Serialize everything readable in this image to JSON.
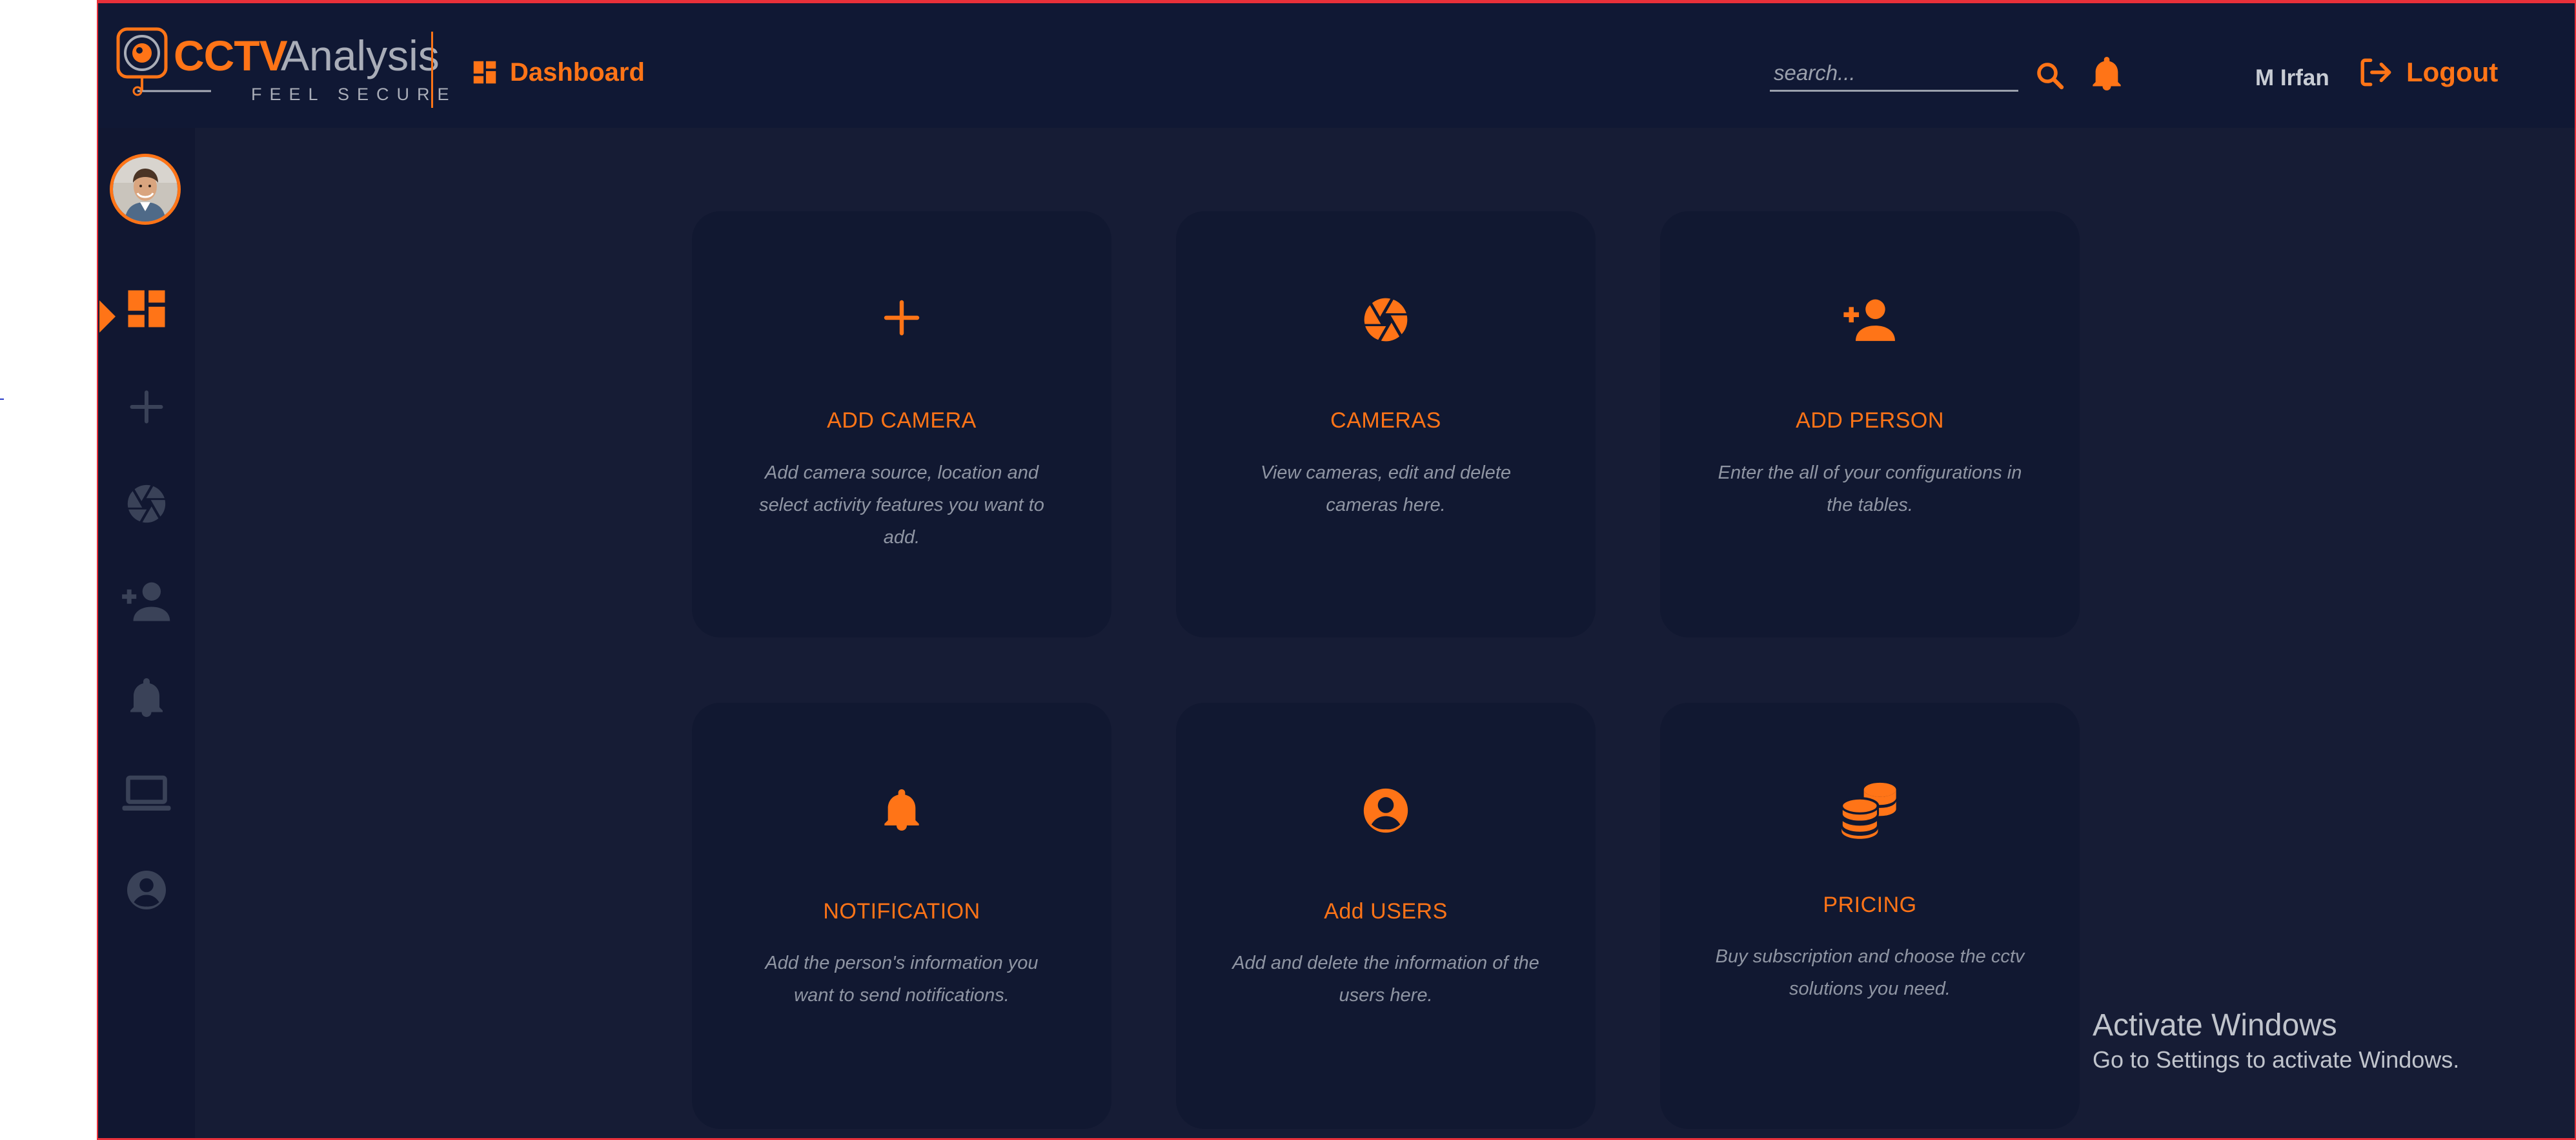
{
  "brand": {
    "name_part1": "CCTV",
    "name_part2": "Analysis",
    "tagline": "FEEL SECURE"
  },
  "header": {
    "nav_label": "Dashboard",
    "search_placeholder": "search...",
    "user_name": "M Irfan",
    "logout_label": "Logout"
  },
  "sidebar": {
    "items": [
      {
        "name": "dashboard",
        "icon": "dashboard-icon",
        "active": true
      },
      {
        "name": "add-camera",
        "icon": "plus-icon",
        "active": false
      },
      {
        "name": "cameras",
        "icon": "aperture-icon",
        "active": false
      },
      {
        "name": "add-person",
        "icon": "person-add-icon",
        "active": false
      },
      {
        "name": "notification",
        "icon": "bell-icon",
        "active": false
      },
      {
        "name": "monitor",
        "icon": "laptop-icon",
        "active": false
      },
      {
        "name": "users",
        "icon": "user-circle-icon",
        "active": false
      }
    ]
  },
  "cards": [
    {
      "title": "ADD CAMERA",
      "description": "Add camera source, location and select activity features you want to add.",
      "icon": "plus-icon"
    },
    {
      "title": "CAMERAS",
      "description": "View cameras, edit and delete cameras here.",
      "icon": "aperture-icon"
    },
    {
      "title": "ADD PERSON",
      "description": "Enter the all of your configurations in the tables.",
      "icon": "person-add-icon"
    },
    {
      "title": "NOTIFICATION",
      "description": "Add the person's information you want to send notifications.",
      "icon": "bell-icon"
    },
    {
      "title": "Add USERS",
      "description": "Add and delete the information of the users here.",
      "icon": "user-circle-icon"
    },
    {
      "title": "PRICING",
      "description": "Buy subscription and choose the cctv solutions you need.",
      "icon": "coins-icon"
    }
  ],
  "watermark": {
    "line1": "Activate Windows",
    "line2": "Go to Settings to activate Windows."
  },
  "colors": {
    "accent": "#ff7417",
    "background": "#161c35",
    "header": "#101834",
    "card": "#111831",
    "muted_icon": "#3a4258"
  }
}
